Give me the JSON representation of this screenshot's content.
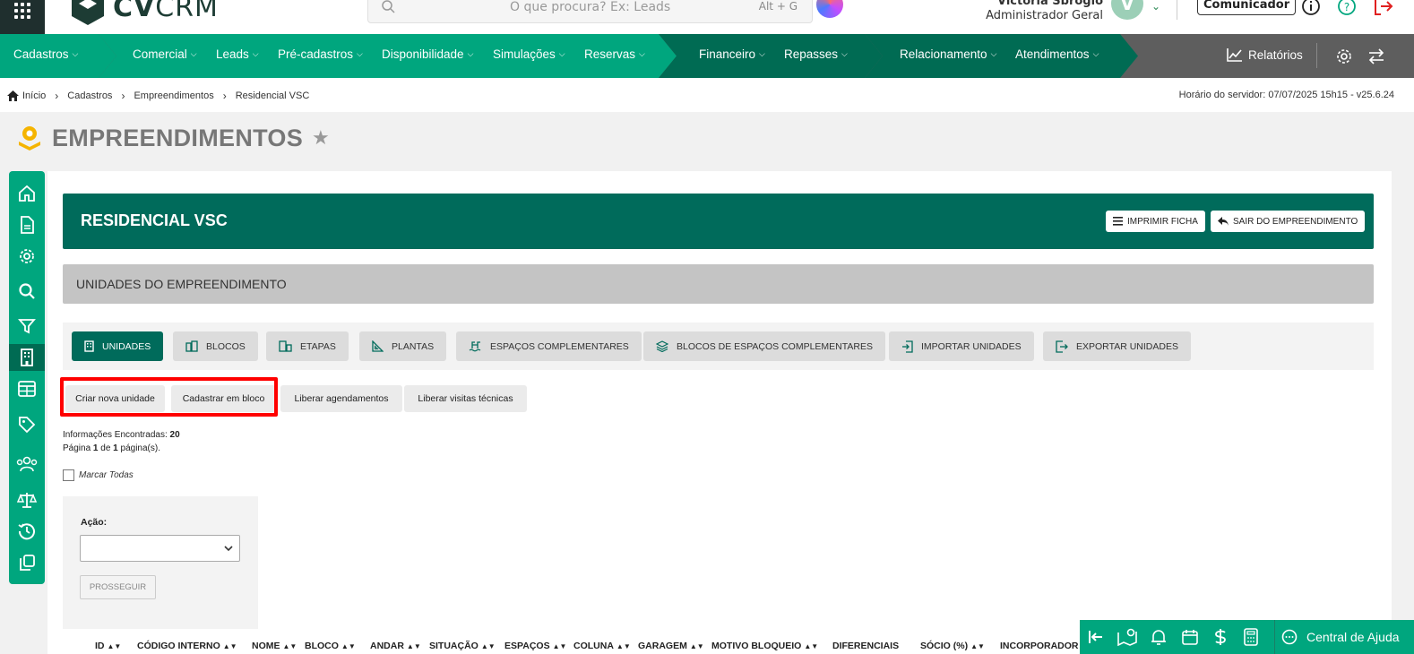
{
  "header": {
    "logo_text_bold": "CV",
    "logo_text_light": "CRM",
    "search_placeholder": "O que procura? Ex: Leads",
    "search_shortcut": "Alt + G",
    "user_name": "Victoria Sbrogio",
    "user_role": "Administrador Geral",
    "avatar_letter": "V",
    "comunicador_label": "Comunicador"
  },
  "nav": {
    "items": [
      {
        "label": "Cadastros"
      },
      {
        "label": "Comercial"
      },
      {
        "label": "Leads"
      },
      {
        "label": "Pré-cadastros"
      },
      {
        "label": "Disponibilidade"
      },
      {
        "label": "Simulações"
      },
      {
        "label": "Reservas"
      },
      {
        "label": "Financeiro"
      },
      {
        "label": "Repasses"
      },
      {
        "label": "Relacionamento"
      },
      {
        "label": "Atendimentos"
      }
    ],
    "reports_label": "Relatórios"
  },
  "breadcrumb": {
    "items": [
      "Início",
      "Cadastros",
      "Empreendimentos",
      "Residencial VSC"
    ],
    "server_time": "Horário do servidor: 07/07/2025 15h15 - v25.6.24"
  },
  "page": {
    "title": "EMPREENDIMENTOS"
  },
  "hero": {
    "title": "RESIDENCIAL VSC",
    "print_label": "IMPRIMIR FICHA",
    "exit_label": "SAIR DO EMPREENDIMENTO"
  },
  "section": {
    "title": "UNIDADES DO EMPREENDIMENTO"
  },
  "tabs": [
    {
      "label": "UNIDADES",
      "active": true
    },
    {
      "label": "BLOCOS"
    },
    {
      "label": "ETAPAS"
    },
    {
      "label": "PLANTAS"
    },
    {
      "label": "ESPAÇOS COMPLEMENTARES"
    },
    {
      "label": "BLOCOS DE ESPAÇOS COMPLEMENTARES"
    },
    {
      "label": "IMPORTAR UNIDADES"
    },
    {
      "label": "EXPORTAR UNIDADES"
    }
  ],
  "actions": [
    {
      "label": "Criar nova unidade"
    },
    {
      "label": "Cadastrar em bloco"
    },
    {
      "label": "Liberar agendamentos"
    },
    {
      "label": "Liberar visitas técnicas"
    }
  ],
  "info": {
    "found_label": "Informações Encontradas:",
    "found_count": "20",
    "page_word": "Página",
    "page_current": "1",
    "page_of": "de",
    "page_total": "1",
    "page_suffix": "página(s)."
  },
  "check_all_label": "Marcar Todas",
  "action_form": {
    "label": "Ação:",
    "selected": "",
    "submit_label": "PROSSEGUIR"
  },
  "table": {
    "columns": [
      "ID",
      "CÓDIGO INTERNO",
      "NOME",
      "BLOCO",
      "ANDAR",
      "SITUAÇÃO",
      "ESPAÇOS",
      "COLUNA",
      "GARAGEM",
      "MOTIVO BLOQUEIO",
      "DIFERENCIAIS",
      "SÓCIO (%)",
      "INCORPORADOR"
    ]
  },
  "helpbar": {
    "label": "Central de Ajuda"
  },
  "colors": {
    "brand_green": "#00a67e",
    "dark_green": "#006b5b",
    "highlight_red": "#ff0000"
  }
}
